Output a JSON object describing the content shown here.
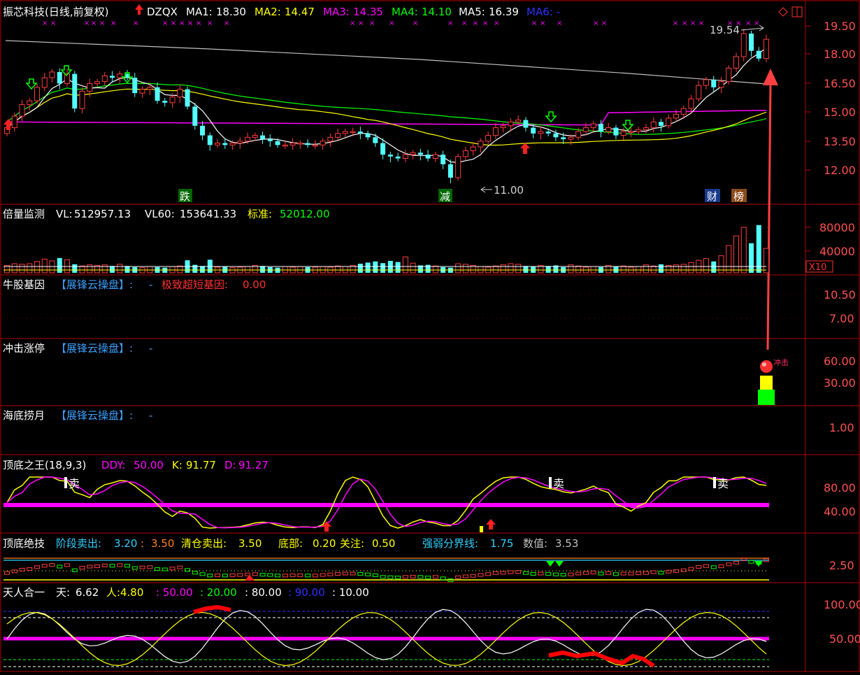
{
  "colors": {
    "bg": "#000000",
    "frame": "#b00000",
    "up": "#ff3c3c",
    "down": "#54ffff",
    "ma1": "#ffffff",
    "ma2": "#ffff00",
    "ma3": "#ff00ff",
    "ma4": "#00ff00",
    "ma5": "#ffffff",
    "ma6": "#0000ff",
    "axis_text": "#ff5050",
    "grid_dot": "#660000"
  },
  "header": {
    "title": "振芯科技(日线,前复权)",
    "indicator": "DZQX",
    "ma1_label": "MA1:",
    "ma1_value": "18.30",
    "ma2_label": "MA2:",
    "ma2_value": "14.47",
    "ma3_label": "MA3:",
    "ma3_value": "14.35",
    "ma4_label": "MA4:",
    "ma4_value": "14.10",
    "ma5_label": "MA5:",
    "ma5_value": "16.39",
    "ma6_label": "MA6:",
    "ma6_value": "-"
  },
  "main_panel": {
    "y_ticks": [
      "19.50",
      "18.00",
      "16.50",
      "15.00",
      "13.50",
      "12.00"
    ],
    "high_label": "19.54",
    "low_label": "11.00",
    "event_labels": [
      {
        "text": "跌",
        "color": "#00ff00"
      },
      {
        "text": "减",
        "color": "#00ff00"
      },
      {
        "text": "财",
        "color": "#ffffff"
      },
      {
        "text": "榜",
        "color": "#ffffff"
      }
    ]
  },
  "volume_panel": {
    "name": "倍量监测",
    "vl_label": "VL:",
    "vl_value": "512957.13",
    "vl60_label": "VL60:",
    "vl60_value": "153641.33",
    "std_label": "标准:",
    "std_value": "52012.00",
    "y_ticks": [
      "80000",
      "40000"
    ],
    "unit_badge": "X10"
  },
  "gene_panel": {
    "name": "牛股基因",
    "tag": "【展锋云操盘】:",
    "dash": "-",
    "sub_label": "极致超短基因:",
    "sub_value": "0.00",
    "y_ticks": [
      "10.50",
      "7.00"
    ]
  },
  "limit_panel": {
    "name": "冲击涨停",
    "tag": "【展锋云操盘】:",
    "dash": "-",
    "y_ticks": [
      "60.00",
      "30.00"
    ],
    "badge_text": "冲击"
  },
  "bottom_fish_panel": {
    "name": "海底捞月",
    "tag": "【展锋云操盘】:",
    "dash": "-",
    "y_ticks": [
      "1.00"
    ]
  },
  "king_panel": {
    "name": "顶底之王(18,9,3)",
    "ddy_label": "DDY:",
    "ddy_value": "50.00",
    "k_label": "K:",
    "k_value": "91.77",
    "d_label": "D:",
    "d_value": "91.27",
    "sell_label": "卖",
    "y_ticks": [
      "80.00",
      "40.00"
    ]
  },
  "skill_panel": {
    "name": "顶底绝技",
    "stage_sell_label": "阶段卖出:",
    "stage_sell_v1": "3.20",
    "stage_sell_v2": "3.50",
    "clear_sell_label": "清仓卖出:",
    "clear_sell_value": "3.50",
    "bottom_label": "底部:",
    "bottom_value": "0.20",
    "focus_label": "关注:",
    "focus_value": "0.50",
    "divider_label": "强弱分界线:",
    "divider_value": "1.75",
    "value_label": "数值:",
    "value_value": "3.53",
    "y_ticks": [
      "2.50"
    ]
  },
  "tianren_panel": {
    "name": "天人合一",
    "tian_label": "天:",
    "tian_value": "6.62",
    "ren_label": "人:",
    "ren_value": "4.80",
    "v1": ": 50.00",
    "v2": ": 20.00",
    "v3": ": 80.00",
    "v4": ": 90.00",
    "v5": ": 10.00",
    "y_ticks": [
      "100.00",
      "50.00"
    ]
  },
  "chart_data": {
    "type": "candlestick",
    "close": [
      14.2,
      14.8,
      15.4,
      15.6,
      16.3,
      16.8,
      17.1,
      16.5,
      17.0,
      15.2,
      16.1,
      16.5,
      16.6,
      16.9,
      16.8,
      17.0,
      16.8,
      16.0,
      16.2,
      16.3,
      15.6,
      15.5,
      15.8,
      16.2,
      15.3,
      14.3,
      13.8,
      13.3,
      13.4,
      13.3,
      13.4,
      13.5,
      13.7,
      13.8,
      13.6,
      13.5,
      13.3,
      13.3,
      13.4,
      13.4,
      13.3,
      13.3,
      13.5,
      13.7,
      13.9,
      14.0,
      14.0,
      13.9,
      13.7,
      13.4,
      12.8,
      12.7,
      12.6,
      12.8,
      12.9,
      12.8,
      12.6,
      12.8,
      12.3,
      11.6,
      12.7,
      13.0,
      13.2,
      13.5,
      13.8,
      14.2,
      14.3,
      14.5,
      14.6,
      14.2,
      13.9,
      14.0,
      13.9,
      13.7,
      13.6,
      13.7,
      14.0,
      14.2,
      14.4,
      14.0,
      14.2,
      13.8,
      14.0,
      14.0,
      14.1,
      14.2,
      14.5,
      14.3,
      14.7,
      14.9,
      15.2,
      15.7,
      16.4,
      16.7,
      16.3,
      16.6,
      17.3,
      17.9,
      19.1,
      18.2,
      17.8,
      18.8
    ],
    "volume_x10": [
      13000,
      16000,
      15000,
      16000,
      20000,
      24000,
      21000,
      26000,
      23000,
      15000,
      12000,
      14000,
      13000,
      14000,
      12000,
      15000,
      12000,
      10000,
      9000,
      11000,
      10000,
      9000,
      11000,
      12000,
      22000,
      14000,
      12000,
      23000,
      10000,
      11000,
      9000,
      10000,
      11000,
      13000,
      12000,
      10000,
      9000,
      11000,
      10000,
      11000,
      10000,
      10000,
      11000,
      10000,
      12000,
      11000,
      13000,
      16000,
      18000,
      20000,
      17000,
      21000,
      19000,
      28000,
      17000,
      13000,
      14000,
      12000,
      10000,
      9000,
      16000,
      15000,
      13000,
      11000,
      10000,
      12000,
      14000,
      16000,
      15000,
      12000,
      11000,
      13000,
      12000,
      13000,
      10000,
      14000,
      12000,
      10000,
      11000,
      10000,
      13000,
      11000,
      12000,
      10000,
      11000,
      14000,
      12000,
      15000,
      13000,
      14000,
      15000,
      18000,
      22000,
      25000,
      20000,
      30000,
      48000,
      65000,
      80000,
      52000,
      84000,
      43000
    ],
    "y_range": [
      11.0,
      20.0
    ]
  }
}
